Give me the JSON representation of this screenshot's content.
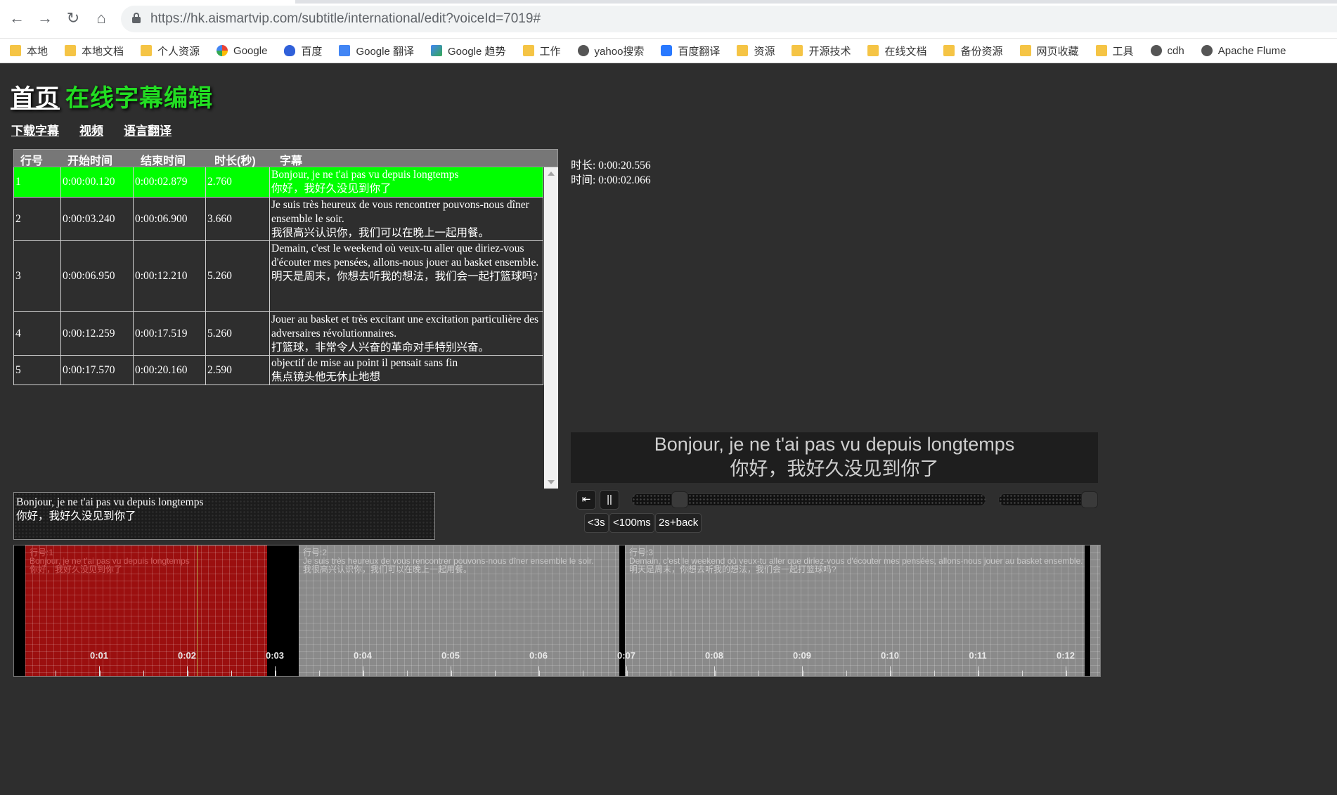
{
  "browser": {
    "url": "https://hk.aismartvip.com/subtitle/international/edit?voiceId=7019#",
    "nav": {
      "back_icon": "←",
      "forward_icon": "→",
      "reload_icon": "↻",
      "home_icon": "⌂"
    },
    "bookmarks": [
      {
        "label": "本地",
        "icon": "folder"
      },
      {
        "label": "本地文档",
        "icon": "folder"
      },
      {
        "label": "个人资源",
        "icon": "folder"
      },
      {
        "label": "Google",
        "icon": "google"
      },
      {
        "label": "百度",
        "icon": "baidu"
      },
      {
        "label": "Google 翻译",
        "icon": "gtrans"
      },
      {
        "label": "Google 趋势",
        "icon": "trends"
      },
      {
        "label": "工作",
        "icon": "folder"
      },
      {
        "label": "yahoo搜索",
        "icon": "globe"
      },
      {
        "label": "百度翻译",
        "icon": "fanyi"
      },
      {
        "label": "资源",
        "icon": "folder"
      },
      {
        "label": "开源技术",
        "icon": "folder"
      },
      {
        "label": "在线文档",
        "icon": "folder"
      },
      {
        "label": "备份资源",
        "icon": "folder"
      },
      {
        "label": "网页收藏",
        "icon": "folder"
      },
      {
        "label": "工具",
        "icon": "folder"
      },
      {
        "label": "cdh",
        "icon": "globe"
      },
      {
        "label": "Apache Flume",
        "icon": "globe"
      }
    ]
  },
  "page": {
    "title_home": "首页",
    "title_sub": "在线字幕编辑",
    "links": [
      "下载字幕",
      "视频",
      "语言翻译"
    ]
  },
  "table": {
    "headers": [
      "行号",
      "开始时间",
      "结束时间",
      "时长(秒)",
      "字幕"
    ],
    "rows": [
      {
        "no": "1",
        "start": "0:00:00.120",
        "end": "0:00:02.879",
        "dur": "2.760",
        "lines": [
          "Bonjour, je ne t'ai pas vu depuis longtemps",
          "你好，我好久没见到你了"
        ],
        "selected": true
      },
      {
        "no": "2",
        "start": "0:00:03.240",
        "end": "0:00:06.900",
        "dur": "3.660",
        "lines": [
          "Je suis très heureux de vous rencontrer pouvons-nous dîner ensemble le soir.",
          "我很高兴认识你，我们可以在晚上一起用餐。"
        ],
        "selected": false
      },
      {
        "no": "3",
        "start": "0:00:06.950",
        "end": "0:00:12.210",
        "dur": "5.260",
        "lines": [
          "Demain, c'est le weekend où veux-tu aller que diriez-vous d'écouter mes pensées, allons-nous jouer au basket ensemble.",
          "明天是周末，你想去听我的想法，我们会一起打篮球吗?"
        ],
        "selected": false
      },
      {
        "no": "4",
        "start": "0:00:12.259",
        "end": "0:00:17.519",
        "dur": "5.260",
        "lines": [
          "Jouer au basket et très excitant une excitation particulière des adversaires révolutionnaires.",
          "打篮球，非常令人兴奋的革命对手特别兴奋。"
        ],
        "selected": false
      },
      {
        "no": "5",
        "start": "0:00:17.570",
        "end": "0:00:20.160",
        "dur": "2.590",
        "lines": [
          "objectif de mise au point il pensait sans fin",
          "焦点镜头他无休止地想"
        ],
        "selected": false
      }
    ]
  },
  "editor": {
    "lines": [
      "Bonjour, je ne t'ai pas vu depuis longtemps",
      "你好，我好久没见到你了"
    ]
  },
  "player": {
    "duration": "时长: 0:00:20.556",
    "time": "时间: 0:00:02.066",
    "subtitle_line1": "Bonjour, je ne t'ai pas vu depuis longtemps",
    "subtitle_line2": "你好，我好久没见到你了",
    "prev_icon": "⇤",
    "pause_icon": "||",
    "progress_fraction": 0.1,
    "volume_fraction": 1.0,
    "buttons": [
      "<3s",
      "<100ms",
      "2s+back"
    ]
  },
  "timeline": {
    "ticks": [
      "0:01",
      "0:02",
      "0:03",
      "0:04",
      "0:05",
      "0:06",
      "0:07",
      "0:08",
      "0:09",
      "0:10",
      "0:11",
      "0:12"
    ],
    "regions": [
      {
        "label": "行号:1",
        "line1": "Bonjour, je ne t'ai pas vu depuis longtemps",
        "line2": "你好，我好久没见到你了",
        "selected": true
      },
      {
        "label": "行号:2",
        "line1": "Je suis très heureux de vous rencontrer pouvons-nous dîner ensemble le soir.",
        "line2": "我很高兴认识你，我们可以在晚上一起用餐。",
        "selected": false
      },
      {
        "label": "行号:3",
        "line1": "Demain, c'est le weekend où veux-tu aller que diriez-vous d'écouter mes pensées, allons-nous jouer au basket ensemble.",
        "line2": "明天是周末，你想去听我的想法，我们会一起打篮球吗?",
        "selected": false
      }
    ],
    "colors": {
      "selected": "#9b0f0f",
      "region": "#8a8a8a",
      "background": "#000000"
    }
  }
}
